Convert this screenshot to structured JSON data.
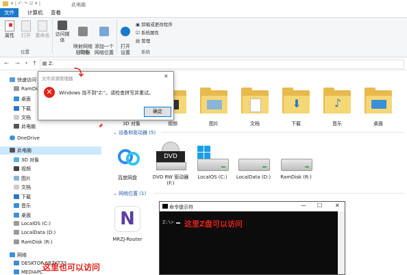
{
  "titlebar": {
    "title": "此电脑"
  },
  "tabs": [
    "文件",
    "计算机",
    "查看"
  ],
  "ribbon": {
    "location_group": {
      "label": "位置",
      "buttons": [
        "属性",
        "打开",
        "重命名"
      ]
    },
    "network_group": {
      "label": "网络",
      "buttons": [
        "访问媒体",
        "映射网络\n驱动器",
        "添加一个\n网络位置"
      ]
    },
    "system_group": {
      "label": "系统",
      "open_settings": "打开\n设置",
      "items": [
        "卸载或更改程序",
        "系统属性",
        "管理"
      ]
    }
  },
  "address": {
    "path": "Z:"
  },
  "nav": {
    "items": [
      "快速访问",
      "RamDisk",
      "桌面",
      "下载",
      "文档",
      "此电脑",
      "OneDrive",
      "此电脑",
      "3D 对象",
      "视频",
      "图片",
      "文档",
      "下载",
      "音乐",
      "桌面",
      "LocalOS (C:)",
      "LocalData (D:)",
      "RamDisk (R:)",
      "网络",
      "DESKTOP-6RZKT73",
      "MEDIAPC"
    ]
  },
  "folders": [
    "3D 对象",
    "视频",
    "图片",
    "文档",
    "下载",
    "音乐",
    "桌面"
  ],
  "sections": {
    "devices": "设备和驱动器 (5)",
    "network_locations": "网络位置 (1)"
  },
  "drives": [
    "百度网盘",
    "DVD RW 驱动器\n(F:)",
    "LocalOS (C:)",
    "LocalData (D:)",
    "RamDisk (R:)"
  ],
  "network_location": "MRZJ-Router",
  "dialog": {
    "title": "文件资源管理器",
    "message": "Windows 找不到\"Z:\"。请检查拼写并重试。",
    "ok": "确定"
  },
  "cmd": {
    "title": "命令提示符",
    "prompt": "Z:\\>",
    "annotation": "这里Z盘可以访问"
  },
  "annotation_bottom": "这里也可以访问",
  "colors": {
    "accent": "#1979ca",
    "annotation": "#e0221a"
  }
}
